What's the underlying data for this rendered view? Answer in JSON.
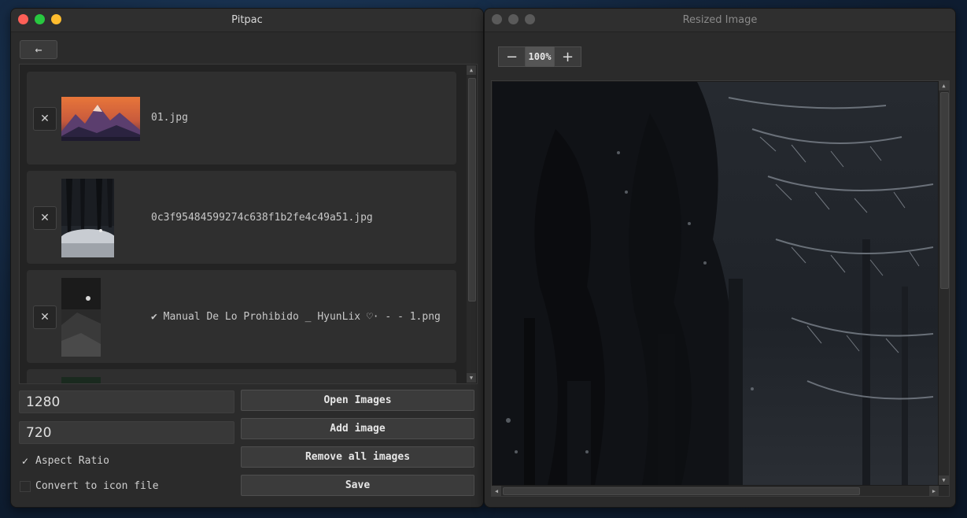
{
  "left_window": {
    "title": "Pitpac",
    "back_icon": "arrow-left-icon",
    "images": [
      {
        "filename": "01.jpg",
        "remove_label": "✕"
      },
      {
        "filename": "0c3f95484599274c638f1b2fe4c49a51.jpg",
        "remove_label": "✕"
      },
      {
        "filename": "✔ Manual De Lo Prohibido _ HyunLix ♡· - - 1.png",
        "remove_label": "✕"
      }
    ],
    "width_value": "1280",
    "height_value": "720",
    "aspect_ratio": {
      "label": "Aspect Ratio",
      "checked": true,
      "mark": "✓"
    },
    "convert_icon": {
      "label": "Convert to icon file",
      "checked": false
    },
    "buttons": {
      "open_images": "Open Images",
      "add_image": "Add image",
      "remove_all": "Remove all images",
      "save": "Save"
    }
  },
  "right_window": {
    "title": "Resized Image",
    "zoom": {
      "minus": "−",
      "value": "100%",
      "plus": "+"
    }
  },
  "colors": {
    "close": "#fe5f57",
    "minimize": "#febc2e",
    "zoom": "#28c840",
    "inactive_light": "#5a5a5a"
  }
}
